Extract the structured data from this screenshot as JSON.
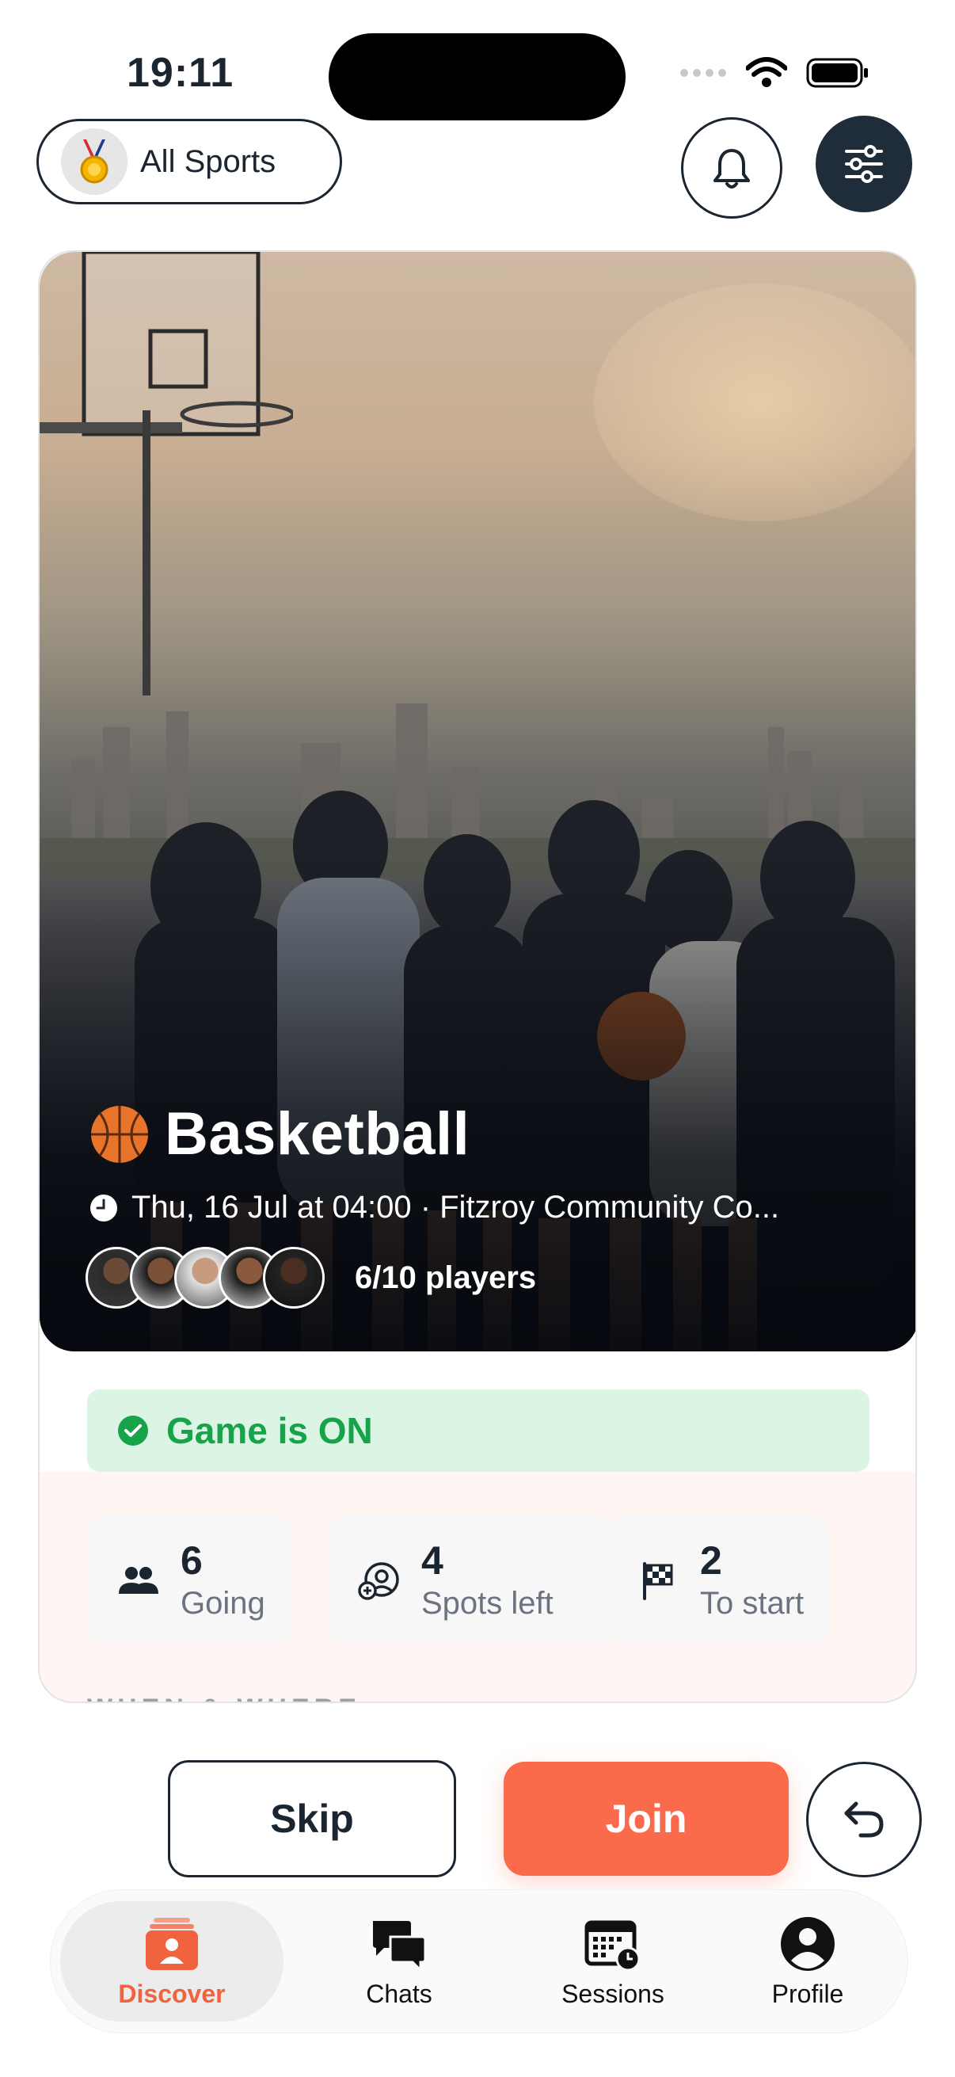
{
  "status_bar": {
    "time": "19:11"
  },
  "top_bar": {
    "sport_filter_label": "All Sports"
  },
  "card": {
    "sport_name": "Basketball",
    "meta": "Thu, 16 Jul at 04:00 · Fitzroy Community Co...",
    "players_label": "6/10 players",
    "status_label": "Game is ON",
    "stats": [
      {
        "value": "6",
        "label": "Going",
        "icon": "people-icon"
      },
      {
        "value": "4",
        "label": "Spots left",
        "icon": "add-person-icon"
      },
      {
        "value": "2",
        "label": "To start",
        "icon": "checkered-flag-icon"
      }
    ],
    "section_label": "WHEN & WHERE"
  },
  "actions": {
    "skip_label": "Skip",
    "join_label": "Join"
  },
  "tabs": [
    {
      "label": "Discover",
      "icon": "discover-icon",
      "active": true
    },
    {
      "label": "Chats",
      "icon": "chats-icon",
      "active": false
    },
    {
      "label": "Sessions",
      "icon": "sessions-icon",
      "active": false
    },
    {
      "label": "Profile",
      "icon": "profile-icon",
      "active": false
    }
  ],
  "colors": {
    "accent": "#fb6a4a",
    "success": "#16a34a",
    "success_bg": "#dcf4e4",
    "dark": "#1f2d3a"
  }
}
